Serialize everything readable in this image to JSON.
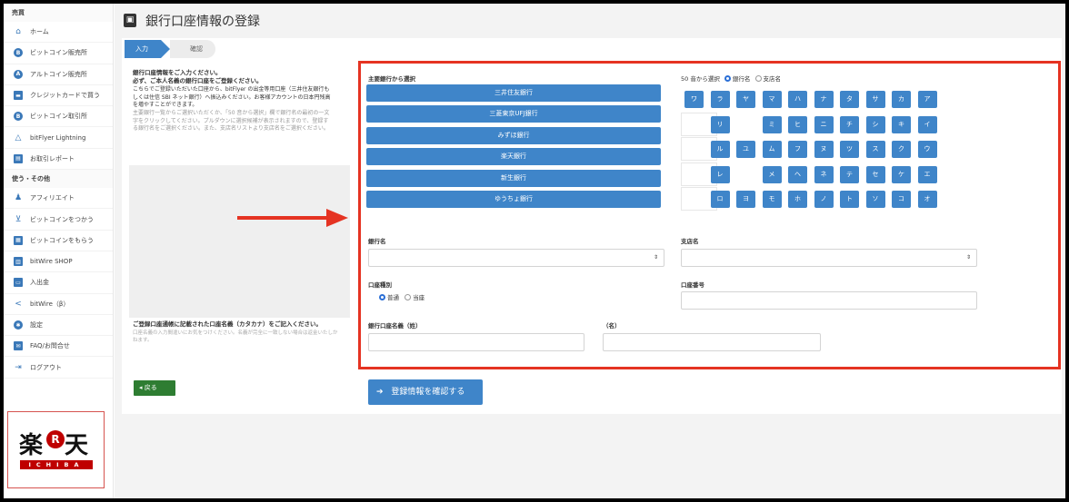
{
  "sidebar": {
    "section1": "売買",
    "items1": [
      {
        "label": "ホーム",
        "icon": "home-icon"
      },
      {
        "label": "ビットコイン販売所",
        "icon": "bitcoin-icon"
      },
      {
        "label": "アルトコイン販売所",
        "icon": "altcoin-icon"
      },
      {
        "label": "クレジットカードで買う",
        "icon": "credit-card-icon"
      },
      {
        "label": "ビットコイン取引所",
        "icon": "bitcoin-exchange-icon"
      },
      {
        "label": "bitFlyer Lightning",
        "icon": "lightning-icon"
      },
      {
        "label": "お取引レポート",
        "icon": "report-icon"
      }
    ],
    "section2": "使う・その他",
    "items2": [
      {
        "label": "アフィリエイト",
        "icon": "affiliate-icon"
      },
      {
        "label": "ビットコインをつかう",
        "icon": "cart-icon"
      },
      {
        "label": "ビットコインをもらう",
        "icon": "receive-icon"
      },
      {
        "label": "bitWire SHOP",
        "icon": "shop-icon"
      },
      {
        "label": "入出金",
        "icon": "deposit-icon"
      },
      {
        "label": "bitWire（β）",
        "icon": "share-icon"
      },
      {
        "label": "設定",
        "icon": "gear-icon"
      },
      {
        "label": "FAQ/お問合せ",
        "icon": "mail-icon"
      },
      {
        "label": "ログアウト",
        "icon": "logout-icon"
      }
    ],
    "logo": {
      "kanji_left": "楽",
      "kanji_mid": "R",
      "kanji_right": "天",
      "sub": "ICHIBA"
    }
  },
  "page": {
    "title": "銀行口座情報の登録"
  },
  "steps": [
    "入力",
    "確認"
  ],
  "instructions": {
    "line1": "銀行口座情報をご入力ください。",
    "line2": "必ず、ご本人名義の銀行口座をご登録ください。",
    "body": "こちらでご登録いただいた口座から、bitFlyer の出金等用口座（三井住友銀行もしくは住信 SBI ネット銀行）へ振込みください。お客様アカウントの日本円残高を増やすことができます。",
    "help": "主要銀行一覧からご選択いただくか、「50 音から選択」欄で銀行名の最初の一文字をクリックしてください。プルダウンに選択候補が表示されますので、登録する銀行名をご選択ください。また、支店名リストより支店名をご選択ください。"
  },
  "kana_note": {
    "title": "ご登録口座通帳に記載された口座名義（カタカナ）をご記入ください。",
    "help": "口座名義の入力間違いにお気をつけください。名義が完全に一致しない場合は返金いたしかねます。"
  },
  "form": {
    "major_banks_label": "主要銀行から選択",
    "banks": [
      "三井住友銀行",
      "三菱東京UFJ銀行",
      "みずほ銀行",
      "楽天銀行",
      "新生銀行",
      "ゆうちょ銀行"
    ],
    "kana_label": "50 音から選択",
    "radio_bank": "銀行名",
    "radio_branch": "支店名",
    "kana_rows": [
      [
        "ワ",
        "ラ",
        "ヤ",
        "マ",
        "ハ",
        "ナ",
        "タ",
        "サ",
        "カ",
        "ア"
      ],
      [
        "",
        "リ",
        "",
        "ミ",
        "ヒ",
        "ニ",
        "チ",
        "シ",
        "キ",
        "イ"
      ],
      [
        "",
        "ル",
        "ユ",
        "ム",
        "フ",
        "ヌ",
        "ツ",
        "ス",
        "ク",
        "ウ"
      ],
      [
        "",
        "レ",
        "",
        "メ",
        "ヘ",
        "ネ",
        "テ",
        "セ",
        "ケ",
        "エ"
      ],
      [
        "",
        "ロ",
        "ヨ",
        "モ",
        "ホ",
        "ノ",
        "ト",
        "ソ",
        "コ",
        "オ"
      ]
    ],
    "bank_name_label": "銀行名",
    "branch_name_label": "支店名",
    "select_arrow": "⇕",
    "account_type_label": "口座種別",
    "account_type_options": [
      "普通",
      "当座"
    ],
    "account_number_label": "口座番号",
    "holder_last_label": "銀行口座名義（姓）",
    "holder_first_label": "（名）"
  },
  "buttons": {
    "back": "戻る",
    "back_icon": "◂",
    "confirm": "登録情報を確認する",
    "confirm_icon": "➔"
  },
  "colors": {
    "accent": "#3f85c9",
    "highlight": "#e53322",
    "back": "#2e7d32"
  }
}
